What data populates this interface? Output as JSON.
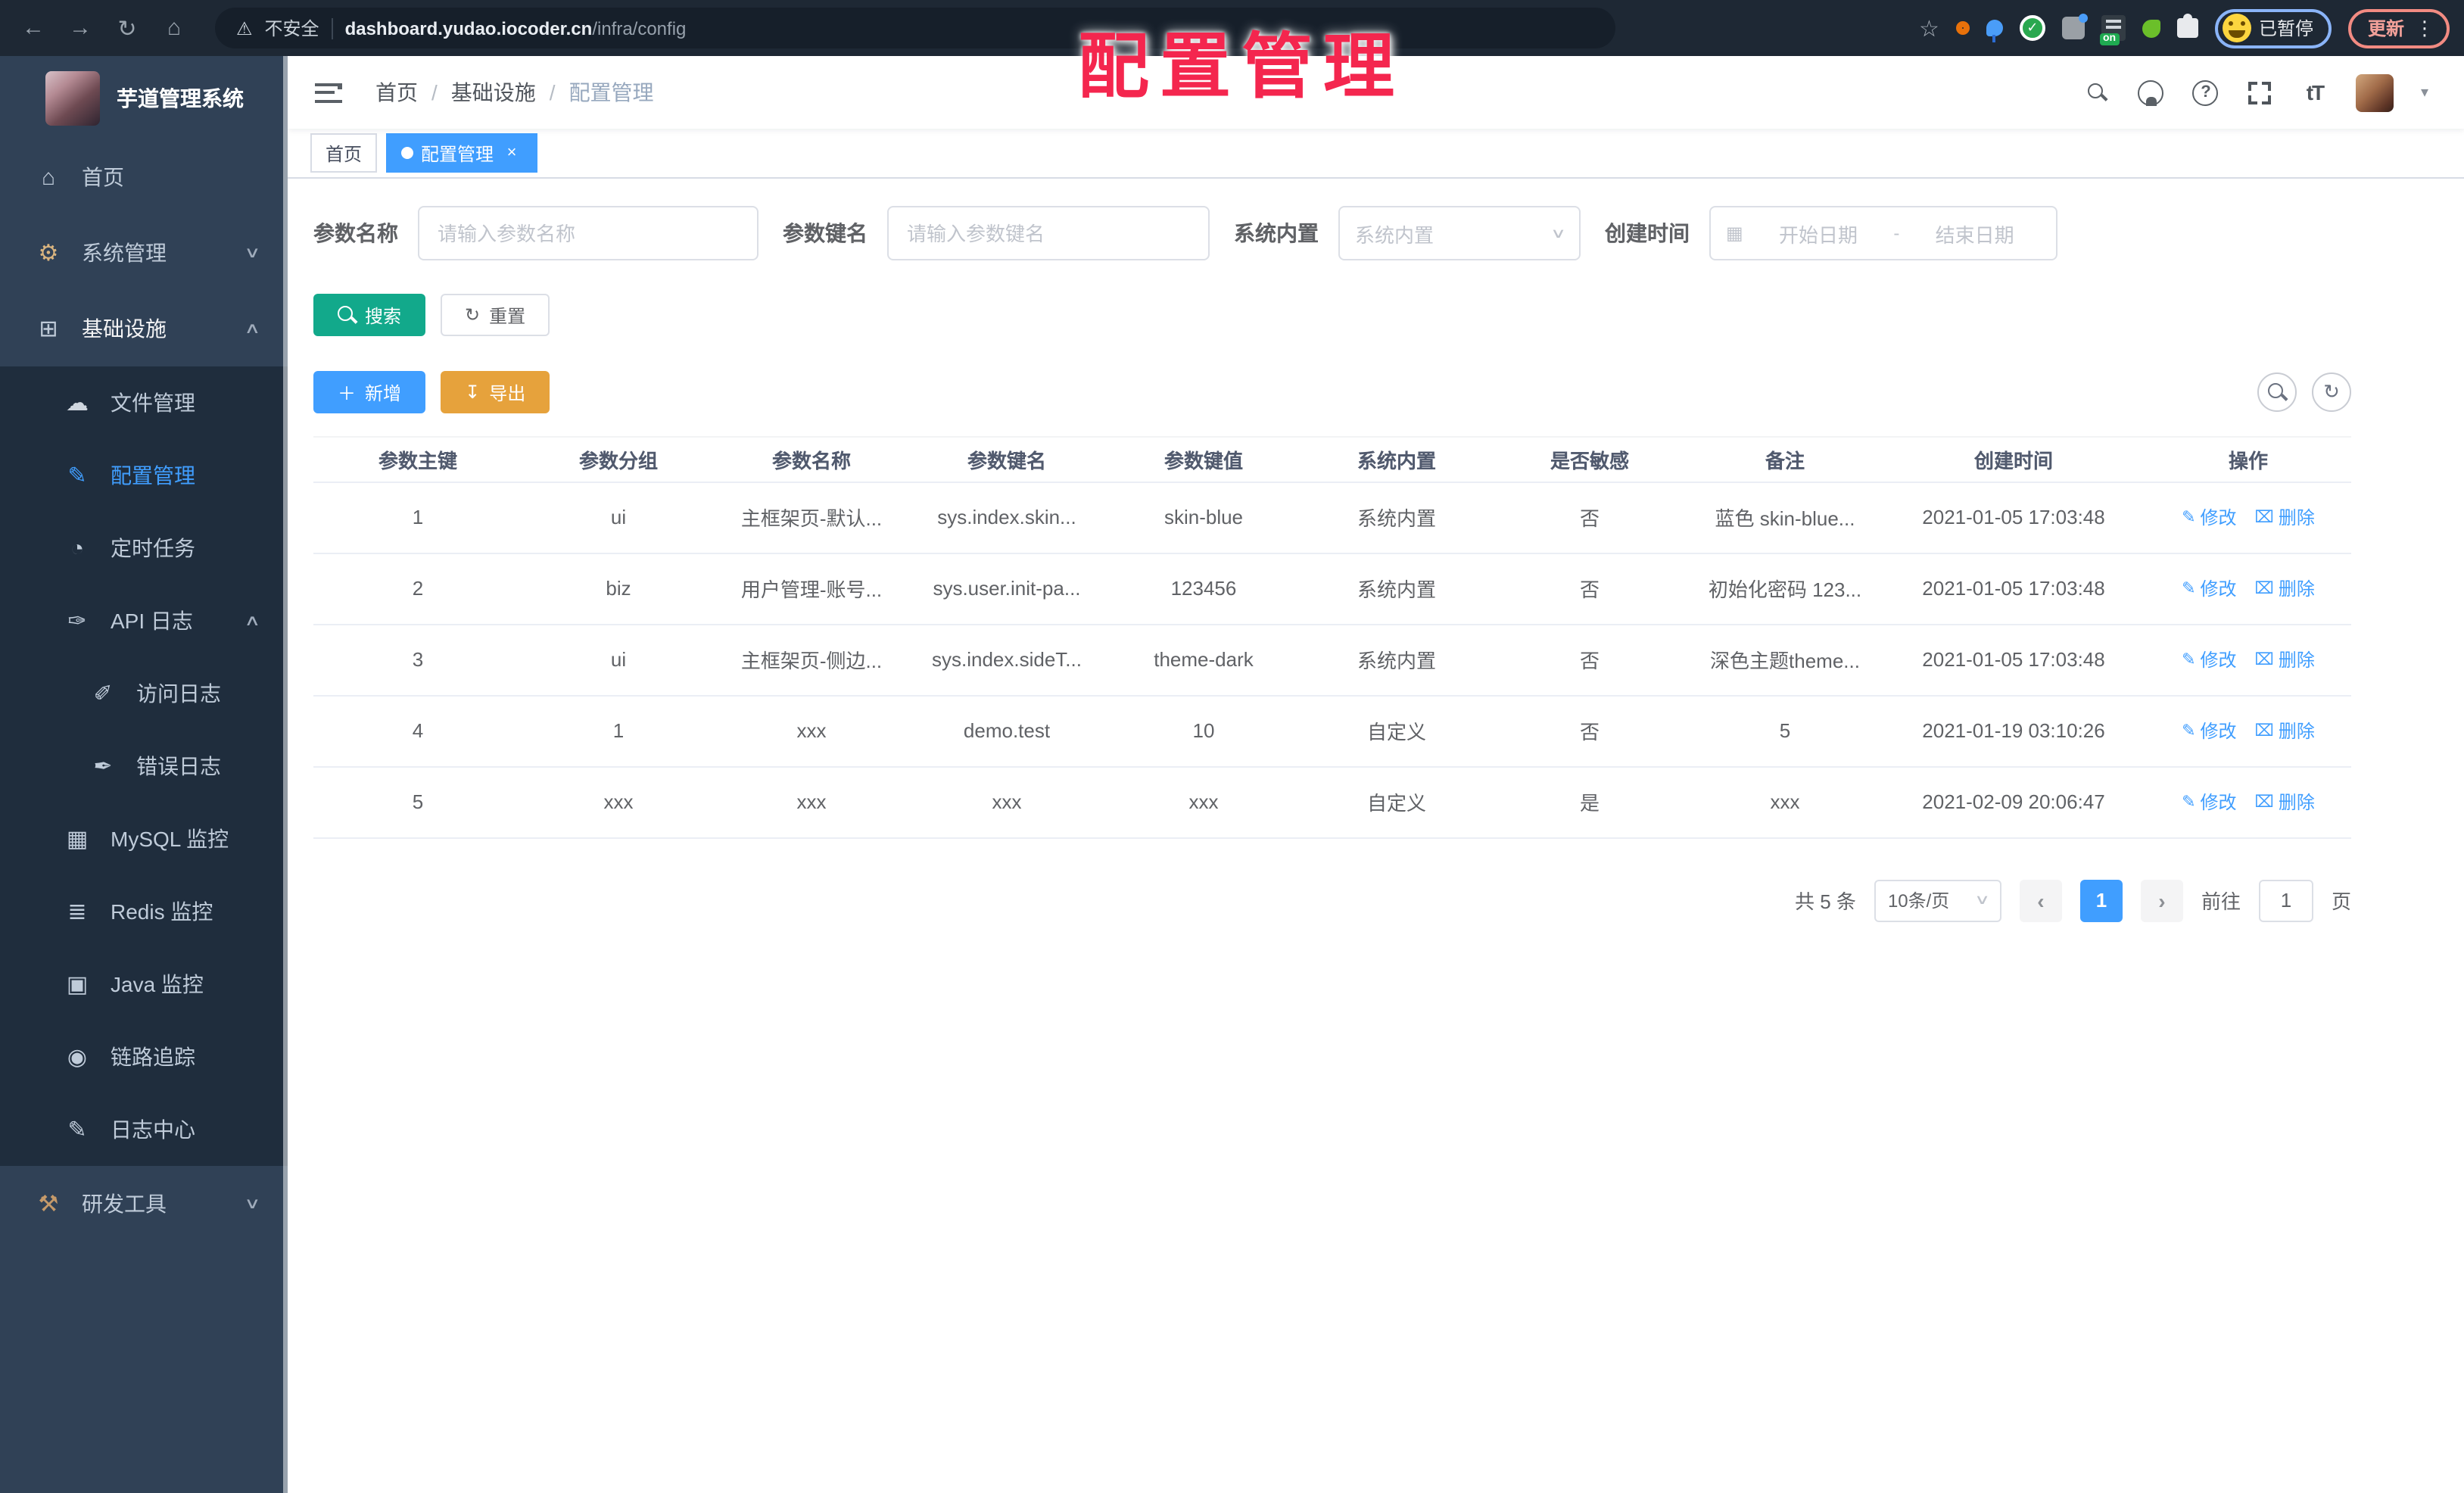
{
  "watermark": {
    "text": "配置管理",
    "color": "#F4264E"
  },
  "browser": {
    "security_label": "不安全",
    "url_host": "dashboard.yudao.iocoder.cn",
    "url_path": "/infra/config",
    "nav_icons": [
      "back",
      "forward",
      "reload",
      "home"
    ],
    "ext_icons": [
      "bookmark-star",
      "ext-orange-ring",
      "ext-blue-pin",
      "ext-green-check",
      "ext-grid",
      "ext-on-badge",
      "ext-leaf",
      "ext-puzzle"
    ],
    "profile_badge": "已暂停",
    "update_label": "更新"
  },
  "sidebar": {
    "title": "芋道管理系统",
    "items": [
      {
        "id": "home",
        "label": "首页",
        "level": 1,
        "icon": "home"
      },
      {
        "id": "system",
        "label": "系统管理",
        "level": 1,
        "icon": "gear",
        "chevron": "down"
      },
      {
        "id": "infra",
        "label": "基础设施",
        "level": 1,
        "icon": "infra",
        "chevron": "up",
        "parent": true
      },
      {
        "id": "file",
        "label": "文件管理",
        "level": 2,
        "icon": "cloud",
        "sub": true
      },
      {
        "id": "config",
        "label": "配置管理",
        "level": 2,
        "icon": "edit",
        "sub": true,
        "active": true
      },
      {
        "id": "job",
        "label": "定时任务",
        "level": 2,
        "icon": "timer",
        "sub": true
      },
      {
        "id": "api-log",
        "label": "API 日志",
        "level": 2,
        "icon": "api",
        "sub": true,
        "chevron": "up"
      },
      {
        "id": "access-log",
        "label": "访问日志",
        "level": 3,
        "icon": "access",
        "sub": true
      },
      {
        "id": "error-log",
        "label": "错误日志",
        "level": 3,
        "icon": "error",
        "sub": true
      },
      {
        "id": "mysql",
        "label": "MySQL 监控",
        "level": 2,
        "icon": "mysql",
        "sub": true
      },
      {
        "id": "redis",
        "label": "Redis 监控",
        "level": 2,
        "icon": "redis",
        "sub": true
      },
      {
        "id": "java",
        "label": "Java 监控",
        "level": 2,
        "icon": "java",
        "sub": true
      },
      {
        "id": "trace",
        "label": "链路追踪",
        "level": 2,
        "icon": "trace",
        "sub": true
      },
      {
        "id": "log-center",
        "label": "日志中心",
        "level": 2,
        "icon": "logcenter",
        "sub": true
      },
      {
        "id": "dev-tools",
        "label": "研发工具",
        "level": 1,
        "icon": "devtool",
        "chevron": "down"
      }
    ]
  },
  "header": {
    "breadcrumb": [
      "首页",
      "基础设施",
      "配置管理"
    ],
    "icons": [
      "search",
      "github",
      "help",
      "fullscreen",
      "text-size",
      "avatar",
      "dropdown-caret"
    ]
  },
  "tabs": [
    {
      "label": "首页",
      "active": false
    },
    {
      "label": "配置管理",
      "active": true
    }
  ],
  "filters": {
    "param_name": {
      "label": "参数名称",
      "placeholder": "请输入参数名称"
    },
    "param_key": {
      "label": "参数键名",
      "placeholder": "请输入参数键名"
    },
    "builtin": {
      "label": "系统内置",
      "placeholder": "系统内置"
    },
    "create_time": {
      "label": "创建时间",
      "start_placeholder": "开始日期",
      "separator": "-",
      "end_placeholder": "结束日期"
    }
  },
  "toolbar": {
    "search": "搜索",
    "reset": "重置",
    "add": "新增",
    "export": "导出"
  },
  "table": {
    "columns": [
      "参数主键",
      "参数分组",
      "参数名称",
      "参数键名",
      "参数键值",
      "系统内置",
      "是否敏感",
      "备注",
      "创建时间",
      "操作"
    ],
    "rows": [
      [
        "1",
        "ui",
        "主框架页-默认...",
        "sys.index.skin...",
        "skin-blue",
        "系统内置",
        "否",
        "蓝色 skin-blue...",
        "2021-01-05 17:03:48"
      ],
      [
        "2",
        "biz",
        "用户管理-账号...",
        "sys.user.init-pa...",
        "123456",
        "系统内置",
        "否",
        "初始化密码 123...",
        "2021-01-05 17:03:48"
      ],
      [
        "3",
        "ui",
        "主框架页-侧边...",
        "sys.index.sideT...",
        "theme-dark",
        "系统内置",
        "否",
        "深色主题theme...",
        "2021-01-05 17:03:48"
      ],
      [
        "4",
        "1",
        "xxx",
        "demo.test",
        "10",
        "自定义",
        "否",
        "5",
        "2021-01-19 03:10:26"
      ],
      [
        "5",
        "xxx",
        "xxx",
        "xxx",
        "xxx",
        "自定义",
        "是",
        "xxx",
        "2021-02-09 20:06:47"
      ]
    ],
    "op_edit": "修改",
    "op_delete": "删除"
  },
  "pagination": {
    "total": "共 5 条",
    "page_size": "10条/页",
    "current": "1",
    "goto_label": "前往",
    "goto_value": "1",
    "unit": "页"
  },
  "colors": {
    "accent": "#409EFF",
    "search_button": "#12A98B",
    "export_button": "#E6A23C",
    "sidebar_bg": "#304156",
    "submenu_bg": "#1f2d3d",
    "watermark": "#F4264E"
  }
}
